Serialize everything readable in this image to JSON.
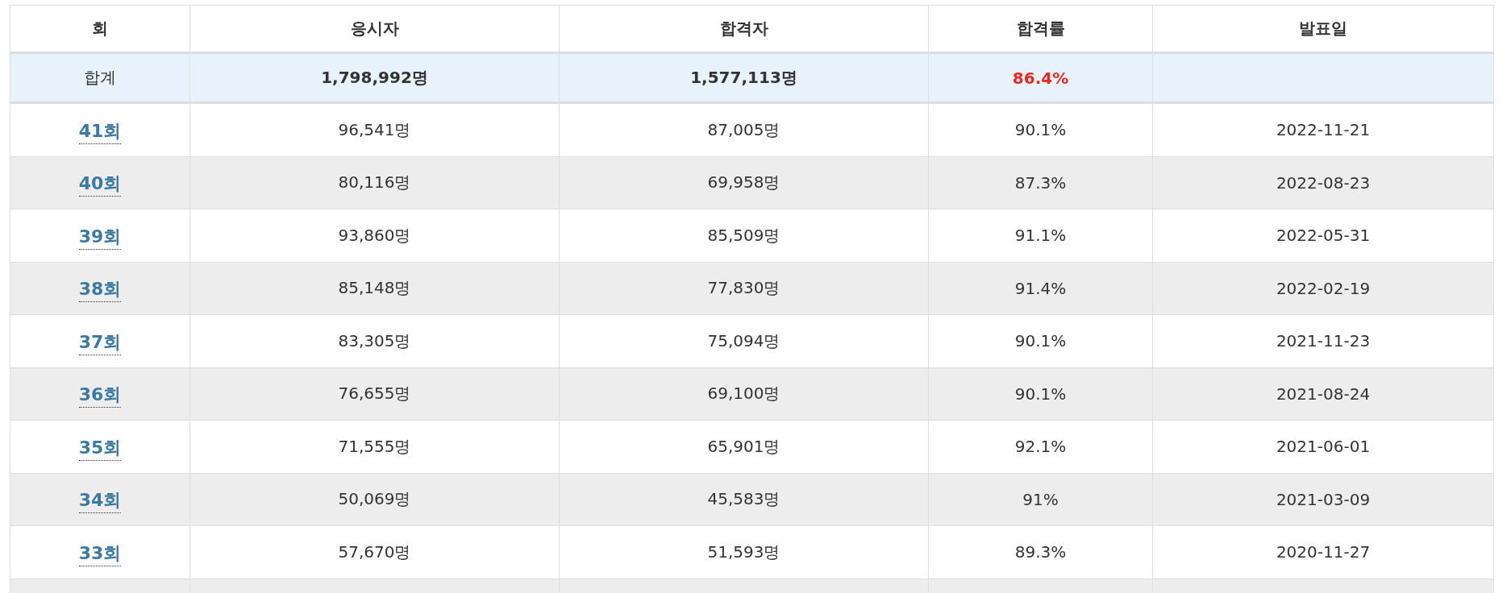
{
  "table": {
    "columns": [
      "회",
      "응시자",
      "합격자",
      "합격률",
      "발표일"
    ],
    "total": {
      "label": "합계",
      "applicants": "1,798,992명",
      "passers": "1,577,113명",
      "rate": "86.4%"
    },
    "rows": [
      {
        "round": "41회",
        "applicants": "96,541명",
        "passers": "87,005명",
        "rate": "90.1%",
        "date": "2022-11-21"
      },
      {
        "round": "40회",
        "applicants": "80,116명",
        "passers": "69,958명",
        "rate": "87.3%",
        "date": "2022-08-23"
      },
      {
        "round": "39회",
        "applicants": "93,860명",
        "passers": "85,509명",
        "rate": "91.1%",
        "date": "2022-05-31"
      },
      {
        "round": "38회",
        "applicants": "85,148명",
        "passers": "77,830명",
        "rate": "91.4%",
        "date": "2022-02-19"
      },
      {
        "round": "37회",
        "applicants": "83,305명",
        "passers": "75,094명",
        "rate": "90.1%",
        "date": "2021-11-23"
      },
      {
        "round": "36회",
        "applicants": "76,655명",
        "passers": "69,100명",
        "rate": "90.1%",
        "date": "2021-08-24"
      },
      {
        "round": "35회",
        "applicants": "71,555명",
        "passers": "65,901명",
        "rate": "92.1%",
        "date": "2021-06-01"
      },
      {
        "round": "34회",
        "applicants": "50,069명",
        "passers": "45,583명",
        "rate": "91%",
        "date": "2021-03-09"
      },
      {
        "round": "33회",
        "applicants": "57,670명",
        "passers": "51,593명",
        "rate": "89.3%",
        "date": "2020-11-27"
      }
    ]
  }
}
